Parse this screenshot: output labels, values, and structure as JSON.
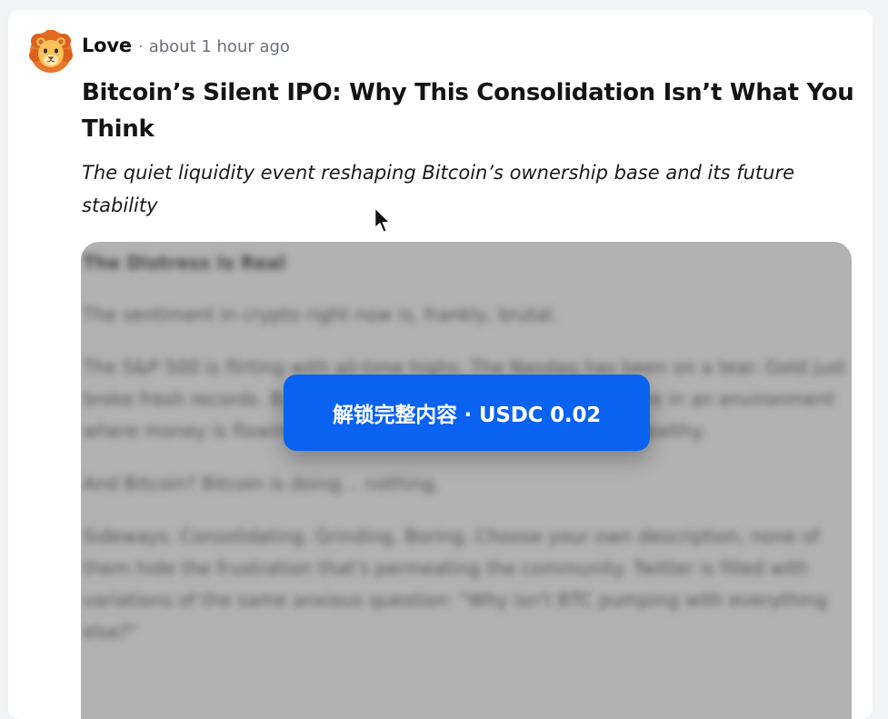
{
  "post": {
    "author": "Love",
    "separator": "·",
    "time": "about 1 hour ago",
    "title": "Bitcoin’s Silent IPO: Why This Consolidation Isn’t What You Think",
    "subtitle": "The quiet liquidity event reshaping Bitcoin’s ownership base and its future stability",
    "avatar_icon": "lion-avatar-icon"
  },
  "paywall": {
    "blurred_paragraphs": [
      "The Distress Is Real",
      "The sentiment in crypto right now is, frankly, brutal.",
      "The S&P 500 is flirting with all-time highs. The Nasdaq has been on a tear. Gold just broke fresh records. By almost every traditional measure, we're in an environment where money is flowing into risk assets. Investor appetite is healthy.",
      "And Bitcoin? Bitcoin is doing… nothing.",
      "Sideways. Consolidating. Grinding. Boring. Choose your own description, none of them hide the frustration that's permeating the community. Twitter is filled with variations of the same anxious question: \"Why isn't BTC pumping with everything else?\""
    ],
    "unlock_label": "解锁完整内容 · USDC 0.02",
    "accent_color": "#0a62f0",
    "overlay_color": "#b2b2b2"
  },
  "cursor": {
    "icon": "mouse-pointer-icon"
  }
}
